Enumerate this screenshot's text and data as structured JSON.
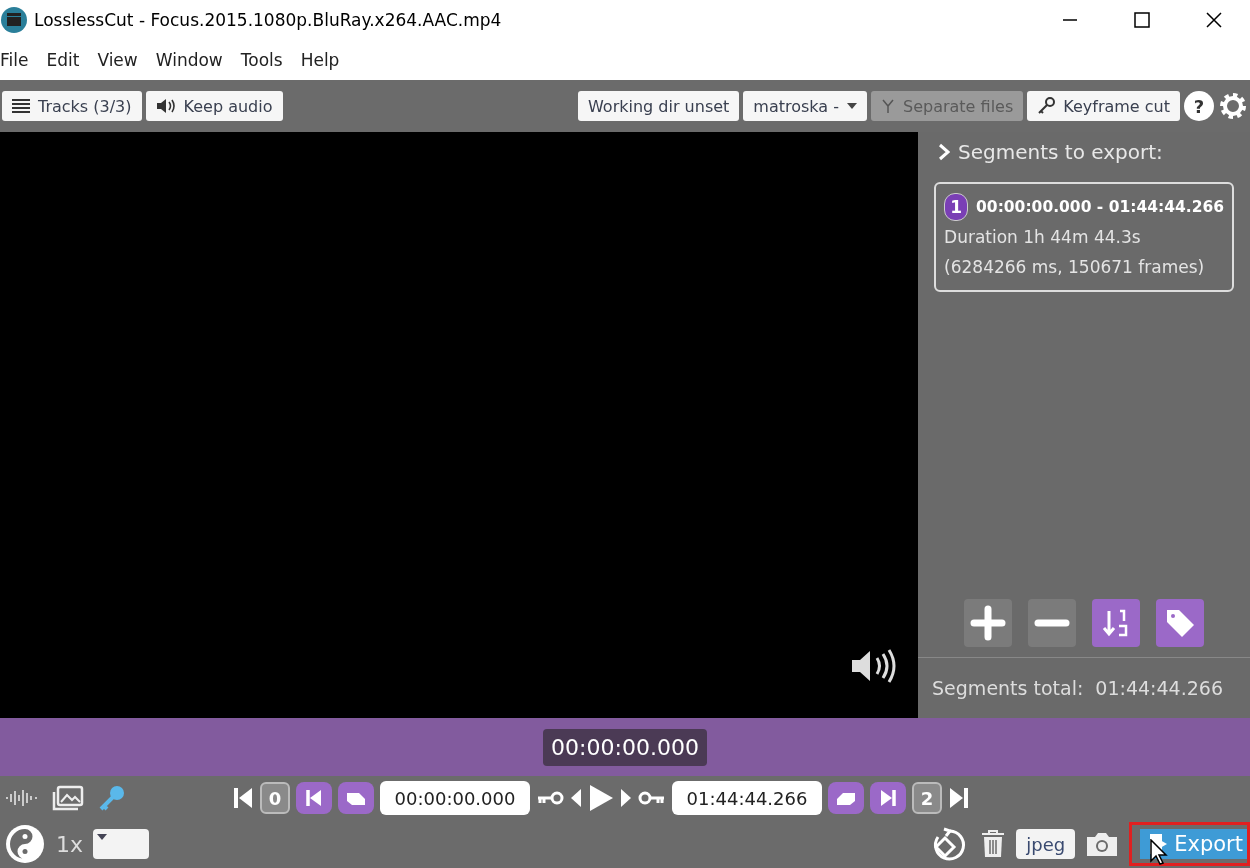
{
  "window": {
    "title": "LosslessCut - Focus.2015.1080p.BluRay.x264.AAC.mp4"
  },
  "menu": [
    "File",
    "Edit",
    "View",
    "Window",
    "Tools",
    "Help"
  ],
  "toolbar": {
    "tracks": "Tracks (3/3)",
    "audio": "Keep audio",
    "working_dir": "Working dir unset",
    "format": "matroska -",
    "toggles": [
      {
        "label": "Separate files",
        "disabled": true
      },
      {
        "label": "Keyframe cut",
        "disabled": false
      }
    ],
    "help": "?"
  },
  "segments": {
    "heading": "Segments to export:",
    "items": [
      {
        "number": "1",
        "range": "00:00:00.000 - 01:44:44.266",
        "duration": "Duration 1h 44m 44.3s",
        "details": "(6284266 ms, 150671 frames)"
      }
    ],
    "total_label": "Segments total:",
    "total": "01:44:44.266"
  },
  "timeline": {
    "current": "00:00:00.000"
  },
  "controls": {
    "start_index": "0",
    "start_time": "00:00:00.000",
    "end_time": "01:44:44.266",
    "end_index": "2"
  },
  "bottom": {
    "speed": "1x",
    "capture_format": "jpeg",
    "export": "Export"
  }
}
